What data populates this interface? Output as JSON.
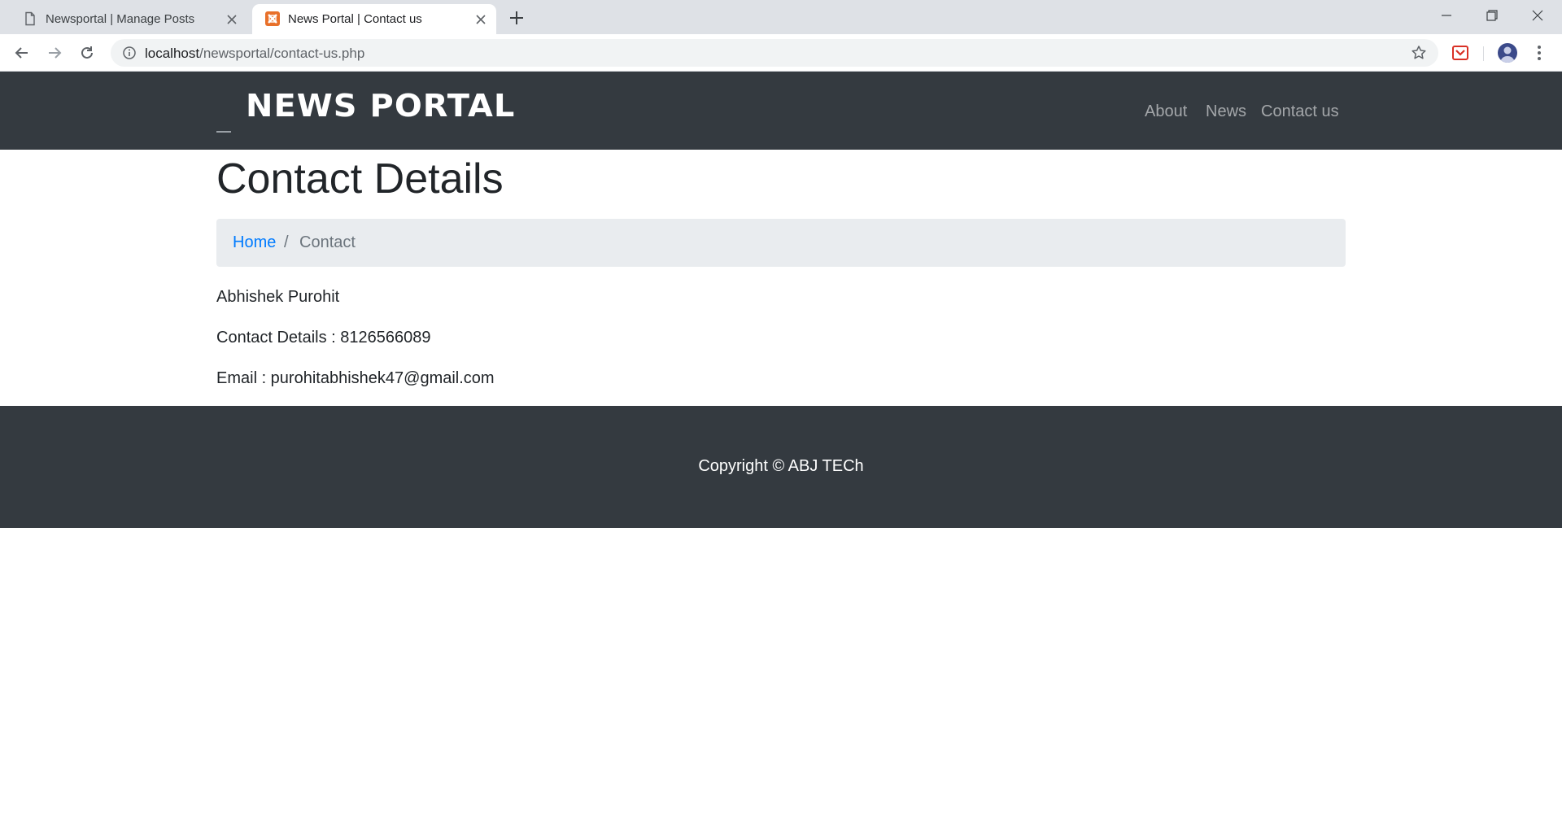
{
  "browser": {
    "tabs": [
      {
        "title": "Newsportal | Manage Posts",
        "active": false
      },
      {
        "title": "News Portal | Contact us",
        "active": true
      }
    ],
    "url_host": "localhost",
    "url_path": "/newsportal/contact-us.php"
  },
  "nav": {
    "brand": "NEWS PORTAL",
    "links": [
      "About",
      "News",
      "Contact us"
    ]
  },
  "page": {
    "title": "Contact Details",
    "breadcrumb": {
      "home": "Home",
      "separator": "/",
      "current": "Contact"
    },
    "name": "Abhishek Purohit",
    "phone_line": "Contact Details : 8126566089",
    "email_line": "Email : purohitabhishek47@gmail.com"
  },
  "footer": {
    "copyright": "Copyright © ABJ TECh"
  },
  "colors": {
    "navbar_bg": "#343a40",
    "breadcrumb_bg": "#e9ecef",
    "link_blue": "#007bff"
  },
  "icons": [
    "document-icon",
    "xampp-icon",
    "close-icon",
    "plus-icon",
    "back-icon",
    "forward-icon",
    "reload-icon",
    "info-icon",
    "star-icon",
    "extension-icon",
    "avatar",
    "menu-icon"
  ]
}
